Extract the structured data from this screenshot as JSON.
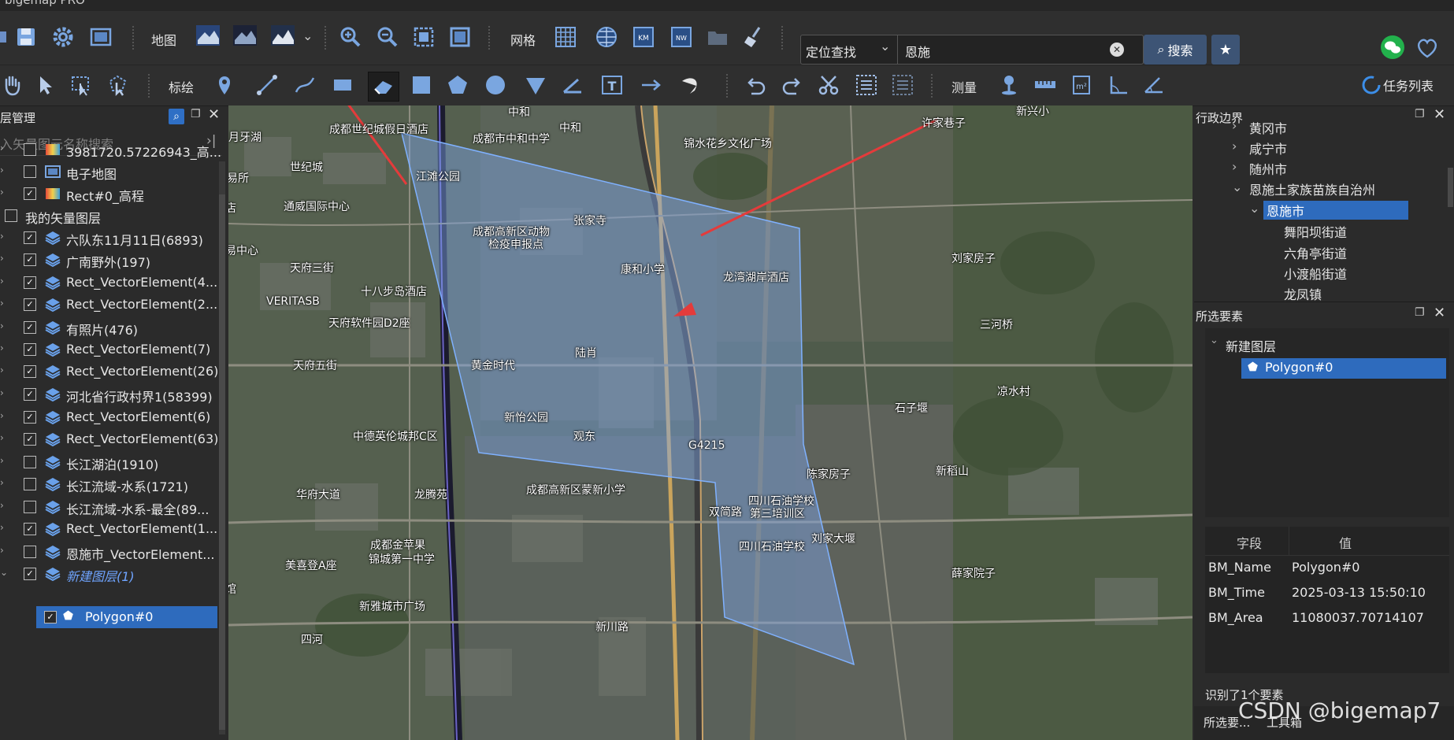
{
  "menubar": {
    "app_title": "bigemap PRO"
  },
  "toolbar1": {
    "map_label": "地图",
    "grid_label": "网格",
    "search": {
      "type": "定位查找",
      "value": "恩施",
      "button": "搜索"
    }
  },
  "toolbar2": {
    "draw_label": "标绘",
    "measure_label": "测量",
    "task_list": "任务列表"
  },
  "left_panel": {
    "title": "层管理",
    "search_placeholder": "入矢量图元名称搜索",
    "items": [
      {
        "label": "3981720.57226943_高...",
        "checked": false,
        "icon": "elevation-icon",
        "expander": "›"
      },
      {
        "label": "电子地图",
        "checked": false,
        "icon": "map-image-icon",
        "expander": "›"
      },
      {
        "label": "Rect#0_高程",
        "checked": true,
        "icon": "elevation-icon",
        "expander": "›"
      },
      {
        "label": "我的矢量图层",
        "checked": false,
        "icon": "folder-icon",
        "expander": ""
      },
      {
        "label": "六队东11月11日(6893)",
        "checked": true,
        "icon": "layer-stack-icon",
        "expander": "›"
      },
      {
        "label": "广南野外(197)",
        "checked": true,
        "icon": "layer-stack-icon",
        "expander": "›"
      },
      {
        "label": "Rect_VectorElement(4...",
        "checked": true,
        "icon": "layer-stack-icon",
        "expander": "›"
      },
      {
        "label": "Rect_VectorElement(2...",
        "checked": true,
        "icon": "layer-stack-icon",
        "expander": "›"
      },
      {
        "label": "有照片(476)",
        "checked": true,
        "icon": "layer-stack-icon",
        "expander": "›"
      },
      {
        "label": "Rect_VectorElement(7)",
        "checked": true,
        "icon": "layer-stack-icon",
        "expander": "›"
      },
      {
        "label": "Rect_VectorElement(26)",
        "checked": true,
        "icon": "layer-stack-icon",
        "expander": "›"
      },
      {
        "label": "河北省行政村界1(58399)",
        "checked": true,
        "icon": "layer-stack-icon",
        "expander": "›"
      },
      {
        "label": "Rect_VectorElement(6)",
        "checked": true,
        "icon": "layer-stack-icon",
        "expander": "›"
      },
      {
        "label": "Rect_VectorElement(63)",
        "checked": true,
        "icon": "layer-stack-icon",
        "expander": "›"
      },
      {
        "label": "长江湖泊(1910)",
        "checked": false,
        "icon": "layer-stack-icon",
        "expander": "›"
      },
      {
        "label": "长江流域-水系(1721)",
        "checked": false,
        "icon": "layer-stack-icon",
        "expander": "›"
      },
      {
        "label": "长江流域-水系-最全(89...",
        "checked": false,
        "icon": "layer-stack-icon",
        "expander": "›"
      },
      {
        "label": "Rect_VectorElement(1...",
        "checked": true,
        "icon": "layer-stack-icon",
        "expander": "›"
      },
      {
        "label": "恩施市_VectorElement...",
        "checked": false,
        "icon": "layer-stack-icon",
        "expander": "›"
      },
      {
        "label": "新建图层(1)",
        "checked": true,
        "icon": "layer-stack-icon",
        "expander": "⌄"
      }
    ],
    "child_item": {
      "label": "Polygon#0",
      "checked": true
    }
  },
  "map": {
    "labels": [
      "月牙湖",
      "成都世纪城假日酒店",
      "成都市中和中学",
      "中和",
      "中和",
      "锦水花乡文化广场",
      "许家巷子",
      "新兴小",
      "世纪城",
      "江滩公园",
      "易所",
      "张家寺",
      "通威国际中心",
      "成都高新区动物",
      "检疫申报点",
      "康和小学",
      "店",
      "龙湾湖岸酒店",
      "易中心",
      "天府三街",
      "十八步岛酒店",
      "刘家房子",
      "VERITASB",
      "天府软件园D2座",
      "三河桥",
      "陆肖",
      "黄金时代",
      "天府五街",
      "新怡公园",
      "观东",
      "石子堰",
      "凉水村",
      "中德英伦城邦C区",
      "G4215",
      "陈家房子",
      "新稻山",
      "华府大道",
      "成都高新区蒙新小学",
      "龙腾苑",
      "四川石油学校",
      "第三培训区",
      "双简路",
      "刘家大堰",
      "成都金苹果",
      "锦城第一中学",
      "四川石油学校",
      "美喜登A座",
      "薛家院子",
      "新雅城市广场",
      "新川路",
      "四河",
      "馆"
    ]
  },
  "right_panel": {
    "admin_title": "行政边界",
    "admin_items": [
      "黄冈市",
      "咸宁市",
      "随州市",
      "恩施土家族苗族自治州",
      "恩施市",
      "舞阳坝街道",
      "六角亭街道",
      "小渡船街道",
      "龙凤镇"
    ],
    "selected_title": "所选要素",
    "layer_name": "新建图层",
    "feature_name": "Polygon#0",
    "table": {
      "headers": [
        "字段",
        "值"
      ],
      "rows": [
        [
          "BM_Name",
          "Polygon#0"
        ],
        [
          "BM_Time",
          "2025-03-13 15:50:10"
        ],
        [
          "BM_Area",
          "11080037.70714107"
        ]
      ]
    },
    "status": "识别了1个要素",
    "tabs": [
      "所选要...",
      "工具箱"
    ],
    "watermark": "CSDN @bigemap7"
  }
}
